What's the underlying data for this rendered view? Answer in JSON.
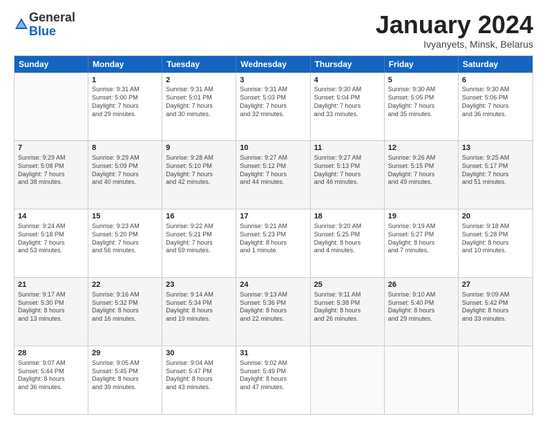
{
  "logo": {
    "general": "General",
    "blue": "Blue"
  },
  "calendar": {
    "title": "January 2024",
    "subtitle": "Ivyanyets, Minsk, Belarus",
    "headers": [
      "Sunday",
      "Monday",
      "Tuesday",
      "Wednesday",
      "Thursday",
      "Friday",
      "Saturday"
    ],
    "rows": [
      [
        {
          "day": "",
          "info": ""
        },
        {
          "day": "1",
          "info": "Sunrise: 9:31 AM\nSunset: 5:00 PM\nDaylight: 7 hours\nand 29 minutes."
        },
        {
          "day": "2",
          "info": "Sunrise: 9:31 AM\nSunset: 5:01 PM\nDaylight: 7 hours\nand 30 minutes."
        },
        {
          "day": "3",
          "info": "Sunrise: 9:31 AM\nSunset: 5:03 PM\nDaylight: 7 hours\nand 32 minutes."
        },
        {
          "day": "4",
          "info": "Sunrise: 9:30 AM\nSunset: 5:04 PM\nDaylight: 7 hours\nand 33 minutes."
        },
        {
          "day": "5",
          "info": "Sunrise: 9:30 AM\nSunset: 5:05 PM\nDaylight: 7 hours\nand 35 minutes."
        },
        {
          "day": "6",
          "info": "Sunrise: 9:30 AM\nSunset: 5:06 PM\nDaylight: 7 hours\nand 36 minutes."
        }
      ],
      [
        {
          "day": "7",
          "info": "Sunrise: 9:29 AM\nSunset: 5:08 PM\nDaylight: 7 hours\nand 38 minutes."
        },
        {
          "day": "8",
          "info": "Sunrise: 9:29 AM\nSunset: 5:09 PM\nDaylight: 7 hours\nand 40 minutes."
        },
        {
          "day": "9",
          "info": "Sunrise: 9:28 AM\nSunset: 5:10 PM\nDaylight: 7 hours\nand 42 minutes."
        },
        {
          "day": "10",
          "info": "Sunrise: 9:27 AM\nSunset: 5:12 PM\nDaylight: 7 hours\nand 44 minutes."
        },
        {
          "day": "11",
          "info": "Sunrise: 9:27 AM\nSunset: 5:13 PM\nDaylight: 7 hours\nand 46 minutes."
        },
        {
          "day": "12",
          "info": "Sunrise: 9:26 AM\nSunset: 5:15 PM\nDaylight: 7 hours\nand 49 minutes."
        },
        {
          "day": "13",
          "info": "Sunrise: 9:25 AM\nSunset: 5:17 PM\nDaylight: 7 hours\nand 51 minutes."
        }
      ],
      [
        {
          "day": "14",
          "info": "Sunrise: 9:24 AM\nSunset: 5:18 PM\nDaylight: 7 hours\nand 53 minutes."
        },
        {
          "day": "15",
          "info": "Sunrise: 9:23 AM\nSunset: 5:20 PM\nDaylight: 7 hours\nand 56 minutes."
        },
        {
          "day": "16",
          "info": "Sunrise: 9:22 AM\nSunset: 5:21 PM\nDaylight: 7 hours\nand 59 minutes."
        },
        {
          "day": "17",
          "info": "Sunrise: 9:21 AM\nSunset: 5:23 PM\nDaylight: 8 hours\nand 1 minute."
        },
        {
          "day": "18",
          "info": "Sunrise: 9:20 AM\nSunset: 5:25 PM\nDaylight: 8 hours\nand 4 minutes."
        },
        {
          "day": "19",
          "info": "Sunrise: 9:19 AM\nSunset: 5:27 PM\nDaylight: 8 hours\nand 7 minutes."
        },
        {
          "day": "20",
          "info": "Sunrise: 9:18 AM\nSunset: 5:28 PM\nDaylight: 8 hours\nand 10 minutes."
        }
      ],
      [
        {
          "day": "21",
          "info": "Sunrise: 9:17 AM\nSunset: 5:30 PM\nDaylight: 8 hours\nand 13 minutes."
        },
        {
          "day": "22",
          "info": "Sunrise: 9:16 AM\nSunset: 5:32 PM\nDaylight: 8 hours\nand 16 minutes."
        },
        {
          "day": "23",
          "info": "Sunrise: 9:14 AM\nSunset: 5:34 PM\nDaylight: 8 hours\nand 19 minutes."
        },
        {
          "day": "24",
          "info": "Sunrise: 9:13 AM\nSunset: 5:36 PM\nDaylight: 8 hours\nand 22 minutes."
        },
        {
          "day": "25",
          "info": "Sunrise: 9:11 AM\nSunset: 5:38 PM\nDaylight: 8 hours\nand 26 minutes."
        },
        {
          "day": "26",
          "info": "Sunrise: 9:10 AM\nSunset: 5:40 PM\nDaylight: 8 hours\nand 29 minutes."
        },
        {
          "day": "27",
          "info": "Sunrise: 9:09 AM\nSunset: 5:42 PM\nDaylight: 8 hours\nand 33 minutes."
        }
      ],
      [
        {
          "day": "28",
          "info": "Sunrise: 9:07 AM\nSunset: 5:44 PM\nDaylight: 8 hours\nand 36 minutes."
        },
        {
          "day": "29",
          "info": "Sunrise: 9:05 AM\nSunset: 5:45 PM\nDaylight: 8 hours\nand 39 minutes."
        },
        {
          "day": "30",
          "info": "Sunrise: 9:04 AM\nSunset: 5:47 PM\nDaylight: 8 hours\nand 43 minutes."
        },
        {
          "day": "31",
          "info": "Sunrise: 9:02 AM\nSunset: 5:49 PM\nDaylight: 8 hours\nand 47 minutes."
        },
        {
          "day": "",
          "info": ""
        },
        {
          "day": "",
          "info": ""
        },
        {
          "day": "",
          "info": ""
        }
      ]
    ]
  }
}
